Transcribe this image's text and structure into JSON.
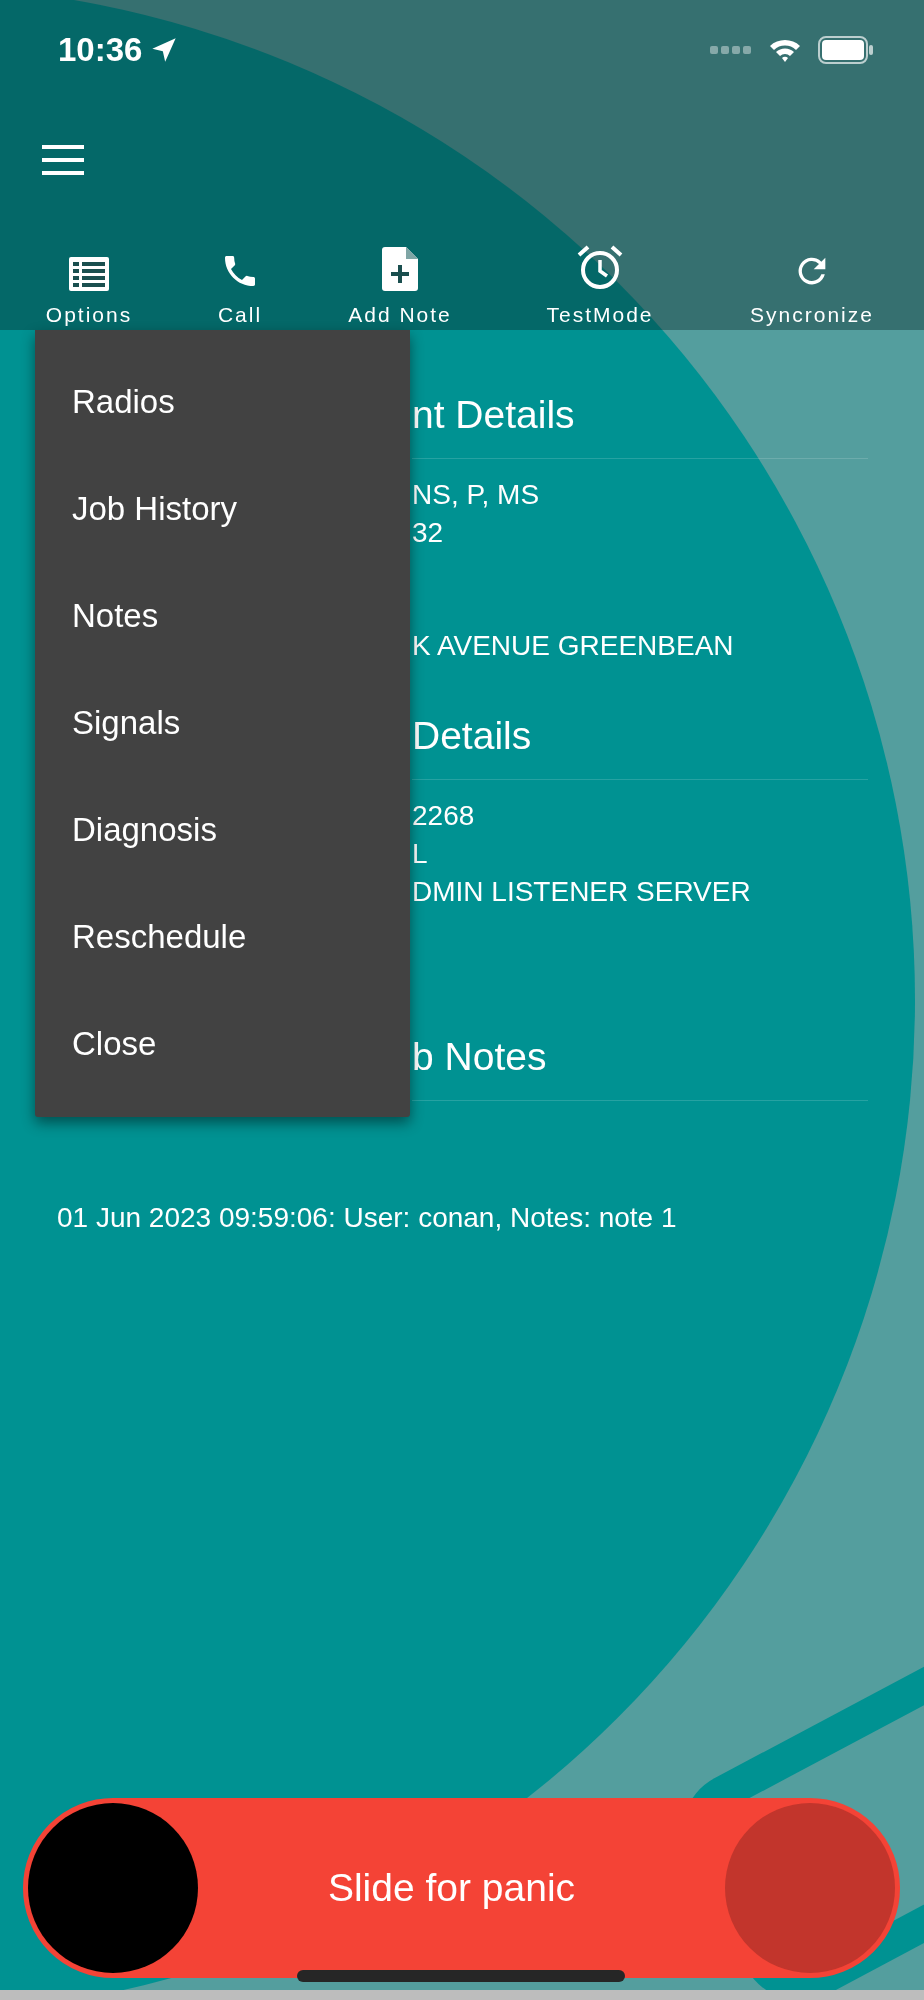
{
  "status_bar": {
    "time": "10:36"
  },
  "toolbar": [
    {
      "label": "Options",
      "kind": "list"
    },
    {
      "label": "Call",
      "kind": "phone"
    },
    {
      "label": "Add Note",
      "kind": "note"
    },
    {
      "label": "TestMode",
      "kind": "alarm"
    },
    {
      "label": "Syncronize",
      "kind": "sync"
    }
  ],
  "menu": {
    "items": [
      "Radios",
      "Job History",
      "Notes",
      "Signals",
      "Diagnosis",
      "Reschedule",
      "Close"
    ]
  },
  "sections": [
    {
      "heading": "nt Details",
      "blocks": [
        [
          "NS, P, MS",
          "32"
        ],
        [
          "K AVENUE GREENBEAN"
        ]
      ]
    },
    {
      "heading": "Details",
      "blocks": [
        [
          "2268",
          "L",
          "DMIN LISTENER SERVER"
        ]
      ]
    },
    {
      "heading": "b Notes"
    }
  ],
  "notes": [
    "01 Jun 2023 09:59:06: User: conan, Notes: note 1"
  ],
  "panic_slider": {
    "label": "Slide for panic",
    "level": 0
  }
}
